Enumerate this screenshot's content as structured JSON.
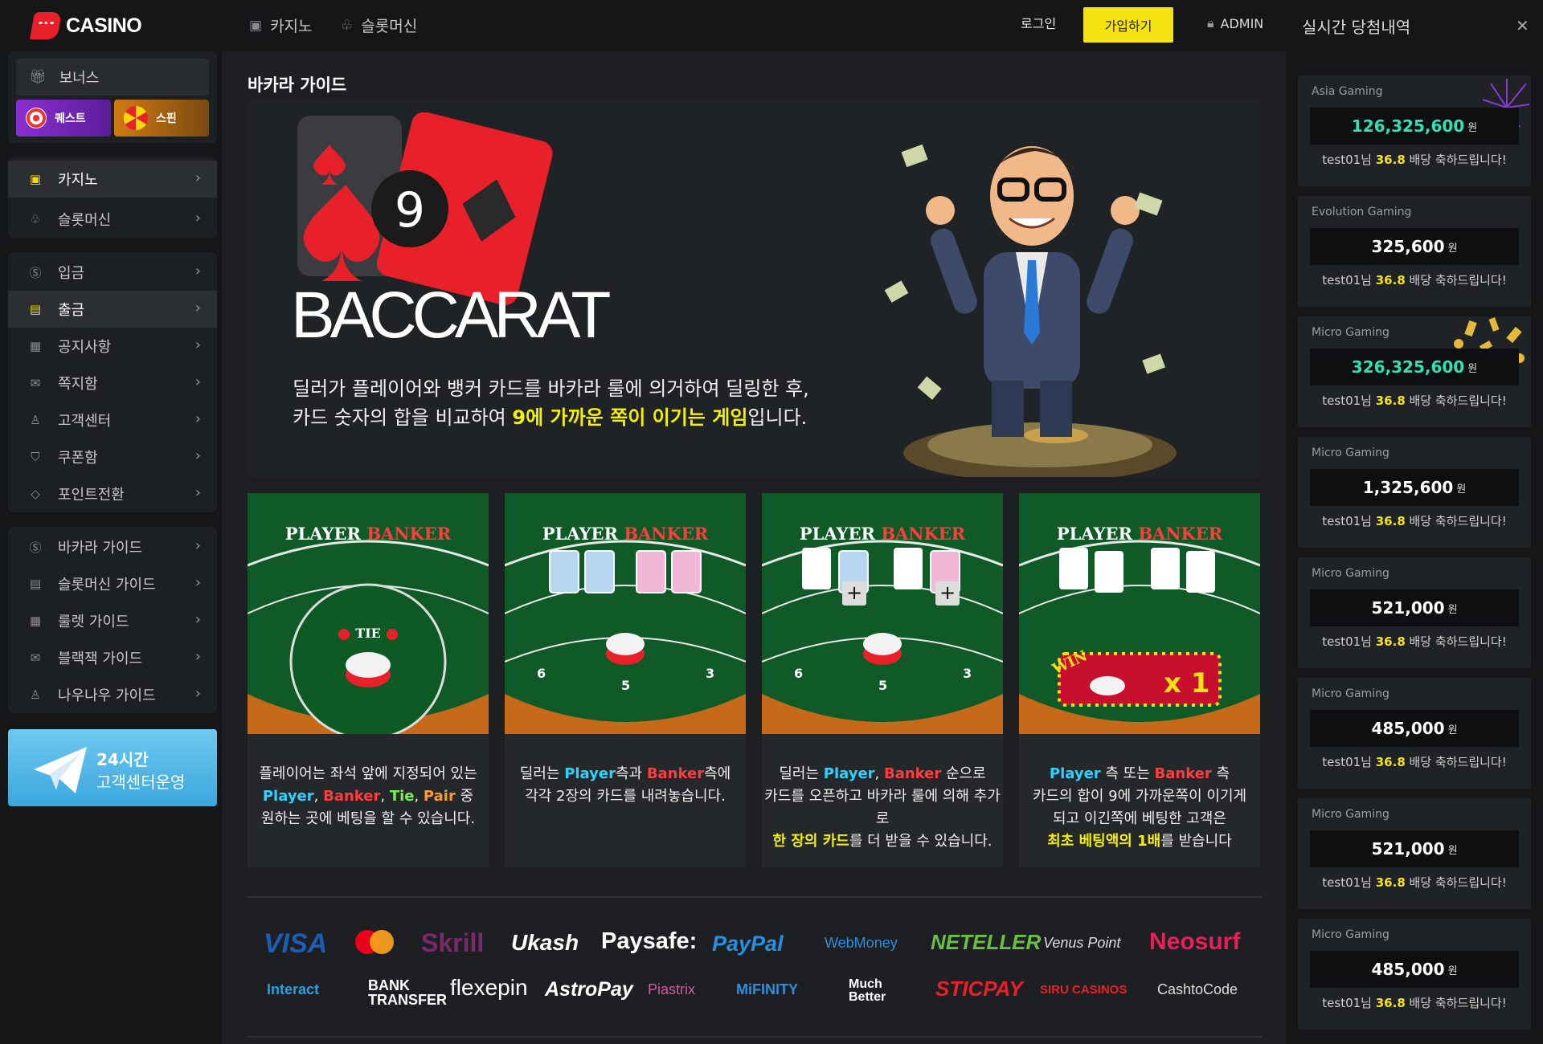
{
  "brand": {
    "name": "CASINO"
  },
  "sidebar": {
    "bonus_label": "보너스",
    "quest_label": "퀘스트",
    "spin_label": "스핀",
    "games": [
      {
        "label": "카지노"
      },
      {
        "label": "슬롯머신"
      }
    ],
    "menu": [
      {
        "label": "입금"
      },
      {
        "label": "출금"
      },
      {
        "label": "공지사항"
      },
      {
        "label": "쪽지함"
      },
      {
        "label": "고객센터"
      },
      {
        "label": "쿠폰함"
      },
      {
        "label": "포인트전환"
      }
    ],
    "guides": [
      {
        "label": "바카라 가이드"
      },
      {
        "label": "슬롯머신 가이드"
      },
      {
        "label": "룰렛 가이드"
      },
      {
        "label": "블랙잭 가이드"
      },
      {
        "label": "나우나우 가이드"
      }
    ],
    "support_banner": {
      "line1": "24시간",
      "line2": "고객센터운영"
    }
  },
  "topbar": {
    "nav": [
      {
        "label": "카지노"
      },
      {
        "label": "슬롯머신"
      }
    ],
    "login": "로그인",
    "join": "가입하기",
    "admin": "ADMIN"
  },
  "main": {
    "title": "바카라 가이드",
    "hero": {
      "card_number": "9",
      "logo_text": "BACCARAT",
      "line1": "딜러가 플레이어와 뱅커 카드를 바카라 룰에 의거하여 딜링한 후,",
      "line2_pre": "카드 숫자의 합을 비교하여 ",
      "line2_hl": "9에 가까운 쪽이 이기는 게임",
      "line2_post": "입니다."
    },
    "table_labels": {
      "player": "PLAYER",
      "banker": "BANKER",
      "tie": "TIE",
      "win": "WIN",
      "x1": "x 1",
      "n6": "6",
      "n5": "5",
      "n3": "3"
    },
    "steps": [
      {
        "l1": "플레이어는 좌석 앞에 지정되어 있는",
        "p": "Player",
        "b": "Banker",
        "t": "Tie",
        "pp": "Pair",
        "l2end": " 중",
        "l3": "원하는 곳에 베팅을 할 수 있습니다.",
        "sep": ", "
      },
      {
        "l1a": "딜러는 ",
        "p": "Player",
        "mid": "측과 ",
        "b": "Banker",
        "l1end": "측에",
        "l2": "각각 2장의 카드를 내려놓습니다."
      },
      {
        "l1a": "딜러는 ",
        "p": "Player",
        "sep": ", ",
        "b": "Banker",
        "l1end": " 순으로",
        "l2": "카드를 오픈하고 바카라 룰에 의해 추가로",
        "hl": "한 장의 카드",
        "l3end": "를 더 받을 수 있습니다."
      },
      {
        "p": "Player",
        "mid": " 측 또는 ",
        "b": "Banker",
        "l1end": " 측",
        "l2": "카드의 합이 9에 가까운쪽이 이기게",
        "l3": "되고 이긴쪽에 베팅한 고객은",
        "hl": "최초 베팅액의 1배",
        "l4end": "를 받습니다"
      }
    ]
  },
  "payments": {
    "row1": [
      "VISA",
      "Skrill",
      "Ukash",
      "Paysafe:",
      "PayPal",
      "WebMoney",
      "NETELLER",
      "Venus Point",
      "Neosurf"
    ],
    "row2": [
      "Interact",
      "BANK TRANSFER",
      "flexepin",
      "AstroPay",
      "Piastrix",
      "MiFINITY",
      "Much Better",
      "STICPAY",
      "SIRU CASINOS",
      "CashtoCode"
    ]
  },
  "right_panel": {
    "title": "실시간 당첨내역",
    "currency": "원",
    "wins": [
      {
        "provider": "Asia Gaming",
        "amount": "126,325,600",
        "user": "test01님",
        "mult": "36.8",
        "msg": "배당 축하드립니다!",
        "highlight": true
      },
      {
        "provider": "Evolution Gaming",
        "amount": "325,600",
        "user": "test01님",
        "mult": "36.8",
        "msg": "배당 축하드립니다!",
        "highlight": false
      },
      {
        "provider": "Micro Gaming",
        "amount": "326,325,600",
        "user": "test01님",
        "mult": "36.8",
        "msg": "배당 축하드립니다!",
        "highlight": true
      },
      {
        "provider": "Micro Gaming",
        "amount": "1,325,600",
        "user": "test01님",
        "mult": "36.8",
        "msg": "배당 축하드립니다!",
        "highlight": false
      },
      {
        "provider": "Micro Gaming",
        "amount": "521,000",
        "user": "test01님",
        "mult": "36.8",
        "msg": "배당 축하드립니다!",
        "highlight": false
      },
      {
        "provider": "Micro Gaming",
        "amount": "485,000",
        "user": "test01님",
        "mult": "36.8",
        "msg": "배당 축하드립니다!",
        "highlight": false
      },
      {
        "provider": "Micro Gaming",
        "amount": "521,000",
        "user": "test01님",
        "mult": "36.8",
        "msg": "배당 축하드립니다!",
        "highlight": false
      },
      {
        "provider": "Micro Gaming",
        "amount": "485,000",
        "user": "test01님",
        "mult": "36.8",
        "msg": "배당 축하드립니다!",
        "highlight": false
      }
    ]
  },
  "colors": {
    "accent": "#f5e212",
    "brand": "#e8202a",
    "player": "#2bd3ff",
    "banker": "#ff3d3d"
  }
}
